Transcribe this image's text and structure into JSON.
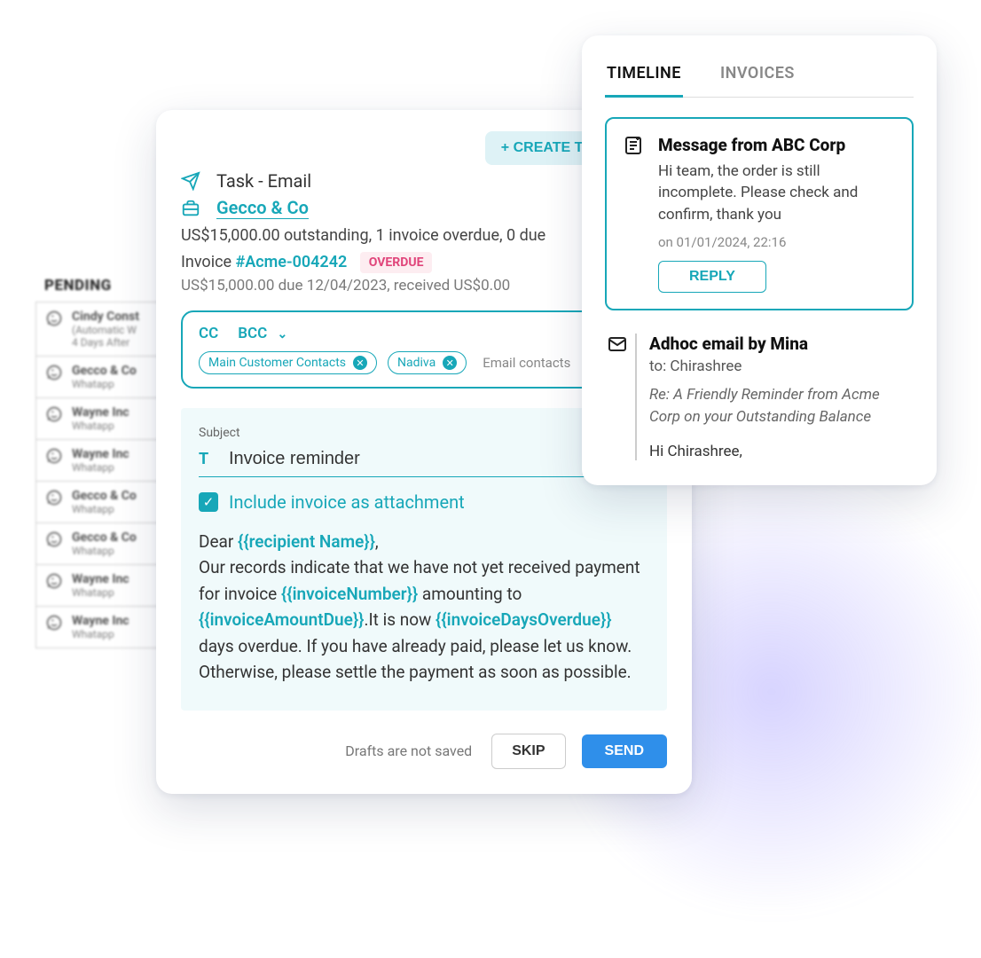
{
  "pending": {
    "heading": "PENDING",
    "items": [
      {
        "title": "Cindy Const",
        "line2": "(Automatic W",
        "line3": "4 Days After"
      },
      {
        "title": "Gecco & Co",
        "line2": "Whatapp"
      },
      {
        "title": "Wayne Inc",
        "line2": "Whatapp"
      },
      {
        "title": "Wayne Inc",
        "line2": "Whatapp"
      },
      {
        "title": "Gecco & Co",
        "line2": "Whatapp"
      },
      {
        "title": "Gecco & Co",
        "line2": "Whatapp"
      },
      {
        "title": "Wayne Inc",
        "line2": "Whatapp"
      },
      {
        "title": "Wayne Inc",
        "line2": "Whatapp"
      }
    ]
  },
  "compose": {
    "create_task": "+ CREATE TASK",
    "task_label": "Task - Email",
    "company": "Gecco & Co",
    "summary": "US$15,000.00 outstanding, 1 invoice overdue, 0 due",
    "invoice_prefix": "Invoice ",
    "invoice_ref": "#Acme-004242",
    "overdue_badge": "OVERDUE",
    "invoice_line": "US$15,000.00 due 12/04/2023, received US$0.00",
    "cc": "CC",
    "bcc": "BCC",
    "chips": [
      "Main Customer Contacts",
      "Nadiva"
    ],
    "email_contacts_placeholder": "Email contacts",
    "subject_label": "Subject",
    "subject_value": "Invoice reminder",
    "attach_label": "Include invoice as attachment",
    "body": {
      "dear": "Dear ",
      "t_recipient": "{{recipient Name}}",
      "comma": ",",
      "p1a": "Our records indicate that we have not yet received payment for invoice ",
      "t_inv": "{{invoiceNumber}}",
      "p1b": " amounting to ",
      "t_amt": "{{invoiceAmountDue}}",
      "p1c": ".It is now ",
      "t_days": "{{invoiceDaysOverdue}}",
      "p1d": " days overdue. If you have already paid, please let us know. Otherwise, please settle the payment as soon as possible."
    },
    "drafts_note": "Drafts are not saved",
    "skip": "SKIP",
    "send": "SEND"
  },
  "timeline": {
    "tab1": "TIMELINE",
    "tab2": "INVOICES",
    "msg": {
      "title": "Message from ABC Corp",
      "body": "Hi team, the order is still incomplete. Please check and confirm, thank you",
      "meta": "on 01/01/2024, 22:16",
      "reply": "REPLY"
    },
    "email": {
      "title": "Adhoc email by Mina",
      "to": "to: Chirashree",
      "subj": "Re: A Friendly Reminder from Acme Corp on your Outstanding Balance",
      "preview": "Hi Chirashree,"
    }
  }
}
